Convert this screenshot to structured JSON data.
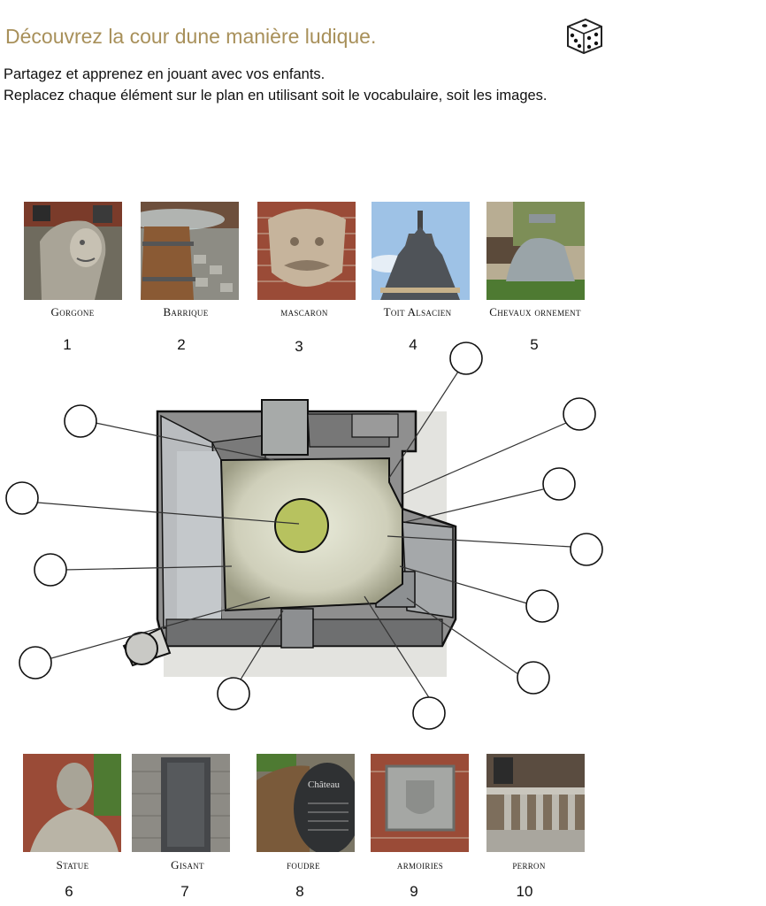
{
  "header": {
    "title": "Découvrez la cour dune manière ludique.",
    "line1": "Partagez et apprenez en jouant avec vos enfants.",
    "line2": "Replacez chaque élément sur le plan en utilisant soit le vocabulaire, soit les images."
  },
  "top_items": [
    {
      "label": "Gorgone",
      "number": "1"
    },
    {
      "label": "Barrique",
      "number": "2"
    },
    {
      "label": "mascaron",
      "number": "3"
    },
    {
      "label": "Toit Alsacien",
      "number": "4"
    },
    {
      "label": "Chevaux ornement",
      "number": "5"
    }
  ],
  "bottom_items": [
    {
      "label": "Statue",
      "number": "6"
    },
    {
      "label": "Gisant",
      "number": "7"
    },
    {
      "label": "foudre",
      "number": "8"
    },
    {
      "label": "armoiries",
      "number": "9"
    },
    {
      "label": "perron",
      "number": "10"
    }
  ],
  "barrel_sign": "Château",
  "icons": {
    "dice": "dice-icon"
  }
}
